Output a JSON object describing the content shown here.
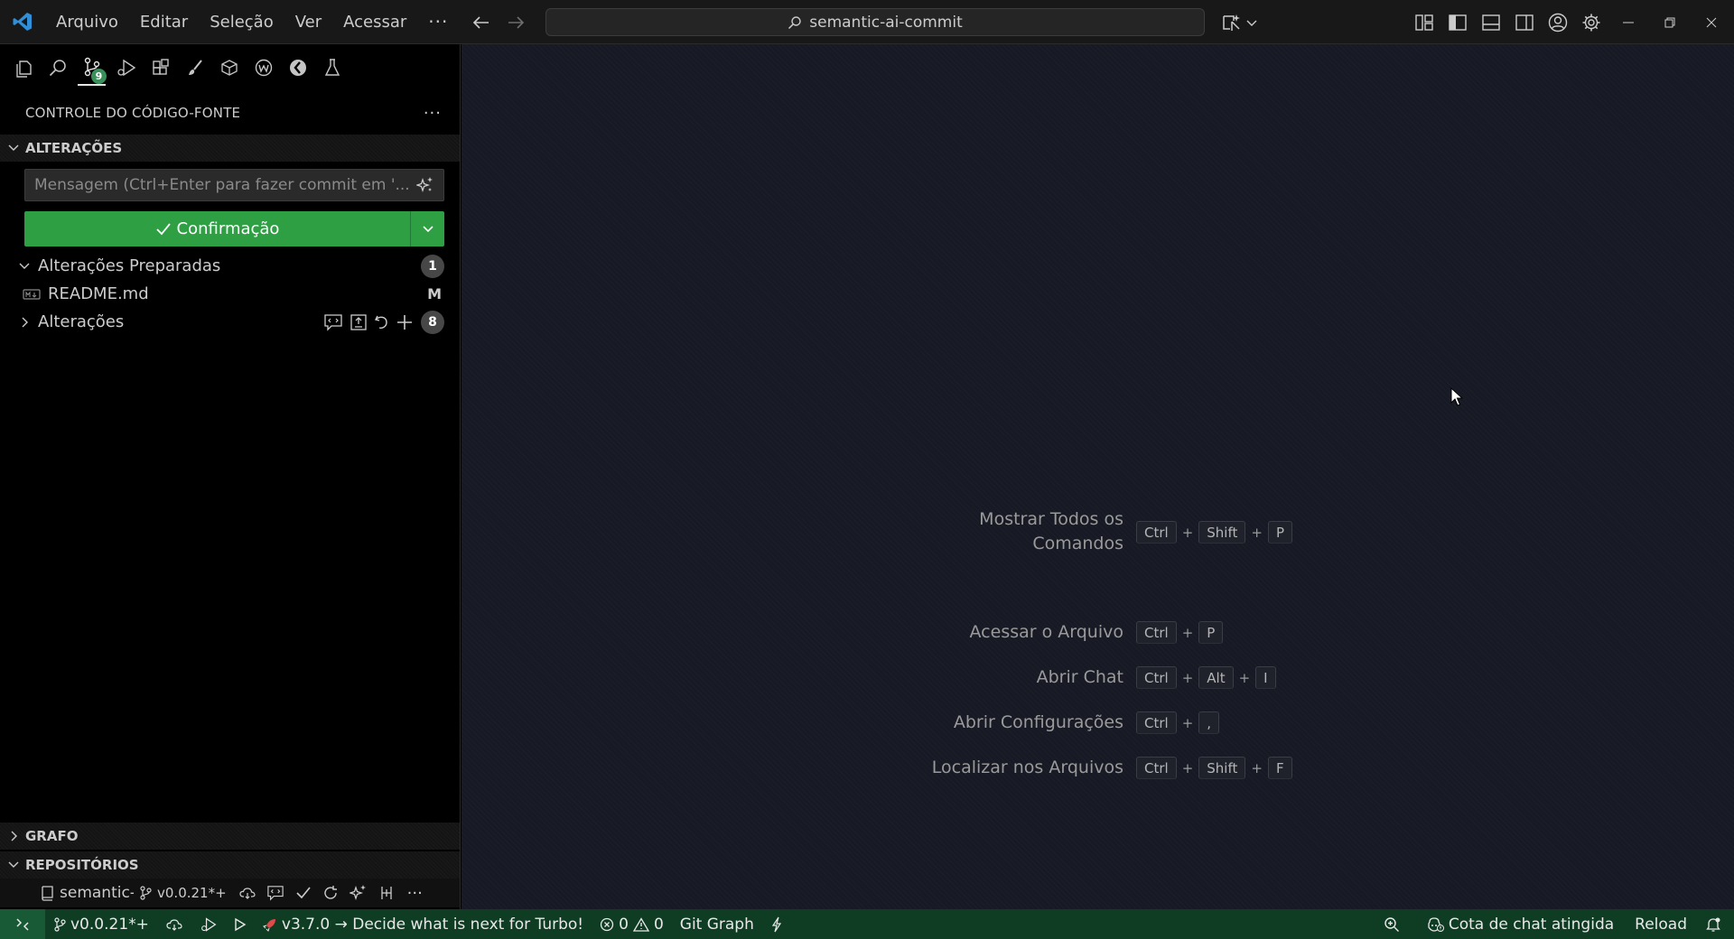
{
  "titlebar": {
    "menu": [
      "Arquivo",
      "Editar",
      "Seleção",
      "Ver",
      "Acessar"
    ],
    "more": "···",
    "search_text": "semantic-ai-commit"
  },
  "activity": {
    "scm_badge": "9"
  },
  "sidebar": {
    "title": "CONTROLE DO CÓDIGO-FONTE",
    "more": "···",
    "changes_section": "ALTERAÇÕES",
    "commit_placeholder": "Mensagem (Ctrl+Enter para fazer commit em '...",
    "commit_button": "Confirmação",
    "staged_group": "Alterações Preparadas",
    "staged_count": "1",
    "staged_file": "README.md",
    "staged_file_status": "M",
    "changes_group": "Alterações",
    "changes_count": "8",
    "graph_section": "GRAFO",
    "repos_section": "REPOSITÓRIOS",
    "repo_name": "semantic-a",
    "repo_branch": "v0.0.21*+"
  },
  "editor": {
    "shortcuts": [
      {
        "label": "Mostrar Todos os Comandos",
        "keys": [
          "Ctrl",
          "Shift",
          "P"
        ]
      },
      {
        "label": "Acessar o Arquivo",
        "keys": [
          "Ctrl",
          "P"
        ]
      },
      {
        "label": "Abrir Chat",
        "keys": [
          "Ctrl",
          "Alt",
          "I"
        ]
      },
      {
        "label": "Abrir Configurações",
        "keys": [
          "Ctrl",
          ","
        ]
      },
      {
        "label": "Localizar nos Arquivos",
        "keys": [
          "Ctrl",
          "Shift",
          "F"
        ]
      }
    ]
  },
  "statusbar": {
    "branch": "v0.0.21*+",
    "turbo": "v3.7.0 → Decide what is next for Turbo!",
    "errors": "0",
    "warnings": "0",
    "git_graph": "Git Graph",
    "chat_quota": "Cota de chat atingida",
    "reload": "Reload"
  },
  "colors": {
    "accent_green": "#2ea043",
    "statusbar_bg": "#0f3d24",
    "editor_bg": "#171a24"
  }
}
